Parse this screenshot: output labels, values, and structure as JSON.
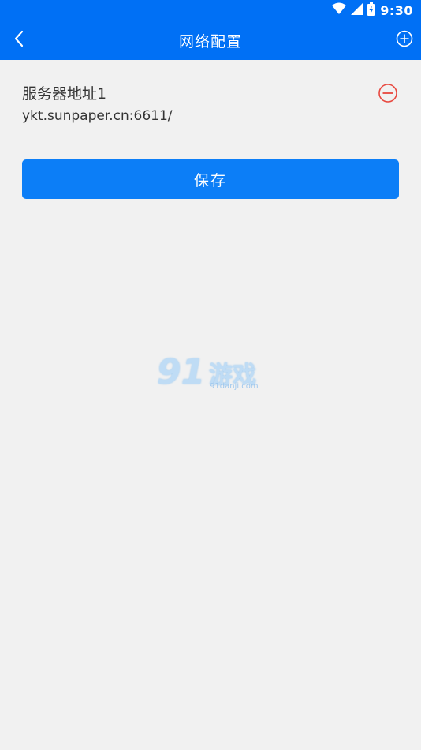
{
  "status_bar": {
    "time": "9:30",
    "icons": [
      "wifi-icon",
      "cell-signal-icon",
      "battery-icon"
    ]
  },
  "toolbar": {
    "title": "网络配置",
    "back_icon": "chevron-left-icon",
    "add_icon": "plus-circle-icon"
  },
  "server": {
    "label": "服务器地址1",
    "value": "ykt.sunpaper.cn:6611/",
    "remove_icon": "minus-circle-icon"
  },
  "actions": {
    "save_label": "保存"
  },
  "watermark": {
    "digits": "91",
    "text": "游戏",
    "domain": "91danji.com"
  },
  "colors": {
    "primary": "#0070f5",
    "button": "#0c7ef7",
    "remove": "#e8483f",
    "background": "#f1f1f1"
  }
}
